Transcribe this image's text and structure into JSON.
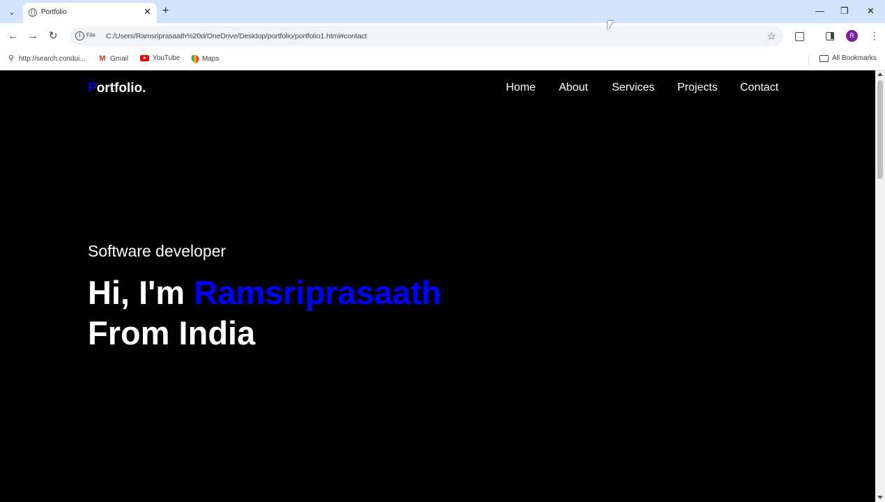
{
  "browser": {
    "tab": {
      "title": "Portfolio",
      "close": "✕"
    },
    "new_tab": "+",
    "window": {
      "minimize": "—",
      "restore": "❐",
      "close": "✕"
    },
    "nav": {
      "back": "←",
      "forward": "→",
      "reload": "↻"
    },
    "address": {
      "chip": "File",
      "url": "C:/Users/Ramsriprasaath%20d/OneDrive/Desktop/portfolio/portfolio1.html#contact"
    },
    "profile_initial": "R",
    "bookmarks": [
      {
        "label": "http://search.condui...",
        "icon": "search-icon"
      },
      {
        "label": "Gmail",
        "icon": "gmail-icon"
      },
      {
        "label": "YouTube",
        "icon": "youtube-icon"
      },
      {
        "label": "Maps",
        "icon": "maps-icon"
      }
    ],
    "all_bookmarks": "All Bookmarks"
  },
  "site": {
    "logo": {
      "first": "P",
      "rest": "ortfolio."
    },
    "nav": [
      "Home",
      "About",
      "Services",
      "Projects",
      "Contact"
    ],
    "hero": {
      "subtitle": "Software developer",
      "greeting": "Hi, I'm ",
      "name": "Ramsriprasaath",
      "line2": "From India"
    }
  },
  "colors": {
    "accent": "#0000ff",
    "background": "#000000",
    "text": "#ffffff",
    "tabstrip": "#d3e3fd"
  }
}
